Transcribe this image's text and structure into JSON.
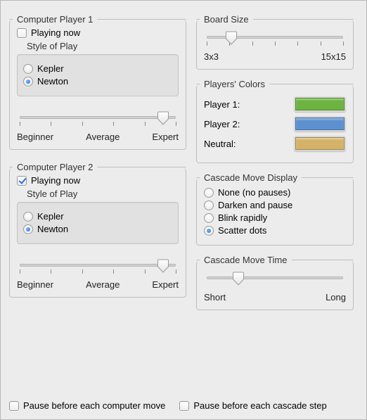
{
  "player1": {
    "title": "Computer Player 1",
    "playing_now": "Playing now",
    "playing_now_checked": false,
    "style_title": "Style of Play",
    "style_options": [
      "Kepler",
      "Newton"
    ],
    "style_selected": "Newton",
    "slider_value": 0.92,
    "slider_labels": [
      "Beginner",
      "Average",
      "Expert"
    ]
  },
  "player2": {
    "title": "Computer Player 2",
    "playing_now": "Playing now",
    "playing_now_checked": true,
    "style_title": "Style of Play",
    "style_options": [
      "Kepler",
      "Newton"
    ],
    "style_selected": "Newton",
    "slider_value": 0.92,
    "slider_labels": [
      "Beginner",
      "Average",
      "Expert"
    ]
  },
  "board_size": {
    "title": "Board Size",
    "min_label": "3x3",
    "max_label": "15x15",
    "value": 0.18,
    "ticks": 7
  },
  "colors": {
    "title": "Players' Colors",
    "rows": [
      {
        "label": "Player 1:",
        "color": "#6cb33f"
      },
      {
        "label": "Player 2:",
        "color": "#5d90cf"
      },
      {
        "label": "Neutral:",
        "color": "#d4b26a"
      }
    ]
  },
  "cascade_display": {
    "title": "Cascade Move Display",
    "options": [
      "None (no pauses)",
      "Darken and pause",
      "Blink rapidly",
      "Scatter dots"
    ],
    "selected": "Scatter dots"
  },
  "cascade_time": {
    "title": "Cascade Move Time",
    "min_label": "Short",
    "max_label": "Long",
    "value": 0.23
  },
  "bottom": {
    "pause_before_computer": {
      "label": "Pause before each computer move",
      "checked": false
    },
    "pause_before_cascade": {
      "label": "Pause before each cascade step",
      "checked": false
    }
  }
}
